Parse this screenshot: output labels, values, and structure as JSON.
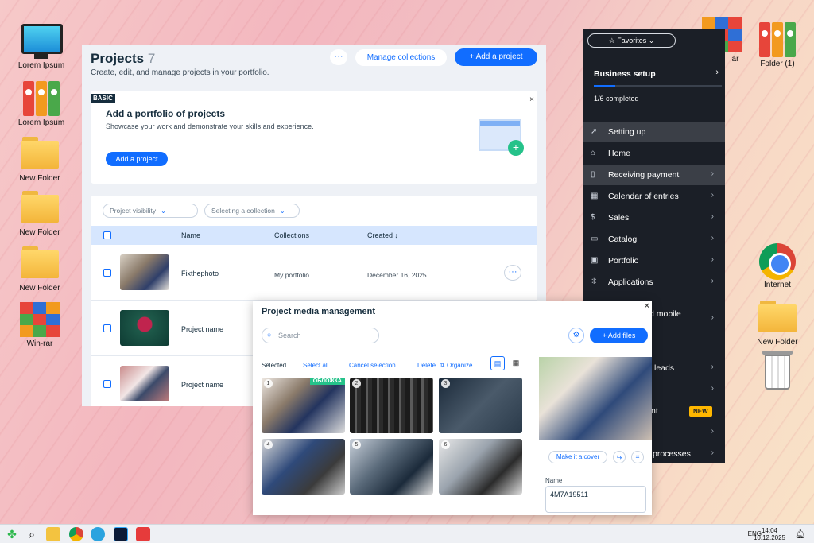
{
  "desktop": {
    "icons_left": [
      "Lorem Ipsum",
      "Lorem Ipsum",
      "New Folder",
      "New Folder",
      "New Folder",
      "Win-rar"
    ],
    "icons_right": [
      "ar",
      "Folder (1)",
      "Internet",
      "New Folder"
    ]
  },
  "projects": {
    "title": "Projects",
    "count": "7",
    "subtitle": "Create, edit, and manage projects in your portfolio.",
    "more_label": "···",
    "manage_label": "Manage collections",
    "add_label": "+ Add a project",
    "basic": {
      "badge": "BASIC",
      "heading": "Add a portfolio of projects",
      "text": "Showcase your work and demonstrate your skills and experience.",
      "button": "Add a project",
      "close": "×"
    },
    "filters": [
      "Project visibility",
      "Selecting a collection"
    ],
    "columns": {
      "name": "Name",
      "collections": "Collections",
      "created": "Created ↓"
    },
    "rows": [
      {
        "name": "Fixthephoto",
        "collection": "My portfolio",
        "date": "December 16, 2025"
      },
      {
        "name": "Project name",
        "collection": "",
        "date": ""
      },
      {
        "name": "Project name",
        "collection": "",
        "date": ""
      }
    ]
  },
  "sidebar": {
    "favorites": "☆ Favorites ⌄",
    "business_title": "Business setup",
    "progress_text": "1/6 completed",
    "progress_fraction": 0.17,
    "items": [
      {
        "label": "Setting up",
        "icon": "rocket-icon"
      },
      {
        "label": "Home",
        "icon": "home-icon"
      },
      {
        "label": "Receiving payment",
        "icon": "payment-icon"
      },
      {
        "label": "Calendar of entries",
        "icon": "calendar-icon"
      },
      {
        "label": "Sales",
        "icon": "dollar-icon"
      },
      {
        "label": "Catalog",
        "icon": "catalog-icon"
      },
      {
        "label": "Portfolio",
        "icon": "portfolio-icon"
      },
      {
        "label": "Applications",
        "icon": "apps-icon"
      },
      {
        "label": "d mobile",
        "icon": ""
      },
      {
        "label": "leads",
        "icon": ""
      },
      {
        "label": "nt",
        "icon": ""
      },
      {
        "label": "processes",
        "icon": ""
      }
    ],
    "new_badge": "NEW"
  },
  "media": {
    "title": "Project media management",
    "search_placeholder": "Search",
    "add_files": "+ Add files",
    "toolbar": {
      "selected": "Selected",
      "select_all": "Select all",
      "cancel": "Cancel selection",
      "delete": "Delete",
      "organize": "Organize"
    },
    "thumbs": [
      "1",
      "2",
      "3",
      "4",
      "5",
      "6"
    ],
    "cover_badge": "ОБЛОЖКА",
    "make_cover": "Make it a cover",
    "name_label": "Name",
    "name_value": "4M7A19511"
  },
  "taskbar": {
    "lang": "ENG",
    "time": "14:04",
    "date": "10.12.2025"
  },
  "colors": {
    "accent": "#116dff",
    "dark_panel": "#1b1f27",
    "green": "#25c28a",
    "badge_yellow": "#ffb700"
  }
}
